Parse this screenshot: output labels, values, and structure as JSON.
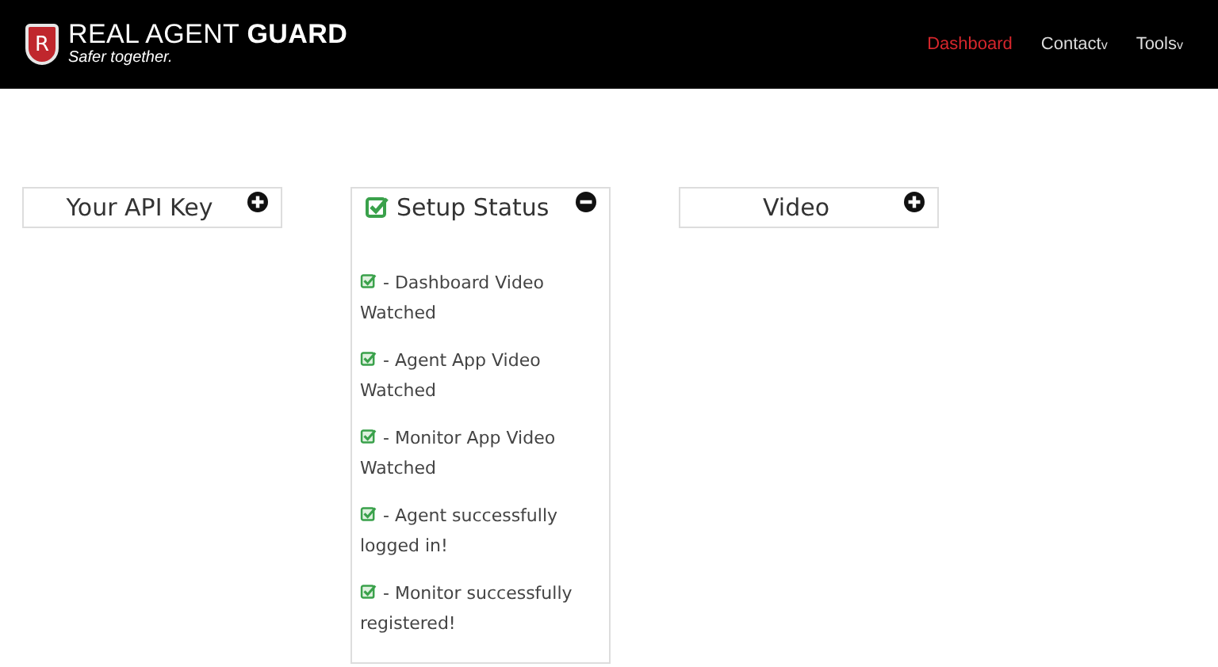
{
  "header": {
    "logo": {
      "mark": "R",
      "brand": "REAL AGENT **GUARD**",
      "tagline": "Safer together."
    },
    "nav": [
      {
        "label": "Dashboard",
        "selected": true
      },
      {
        "label": "Contact",
        "selected": false,
        "caret": "v"
      },
      {
        "label": "Tools",
        "selected": false,
        "caret": "v"
      }
    ]
  },
  "panels": [
    {
      "title": "Your API Key",
      "expanded": false,
      "checked": false
    },
    {
      "title": "Setup Status",
      "expanded": true,
      "checked": true,
      "items": [
        {
          "text": "- Dashboard Video Watched",
          "checked": true
        },
        {
          "text": "- Agent App Video Watched",
          "checked": true
        },
        {
          "text": "- Monitor App Video Watched",
          "checked": true
        },
        {
          "text": "- Agent successfully logged in!",
          "checked": true
        },
        {
          "text": "- Monitor successfully registered!",
          "checked": true
        }
      ]
    },
    {
      "title": "Video",
      "expanded": false,
      "checked": false
    }
  ]
}
